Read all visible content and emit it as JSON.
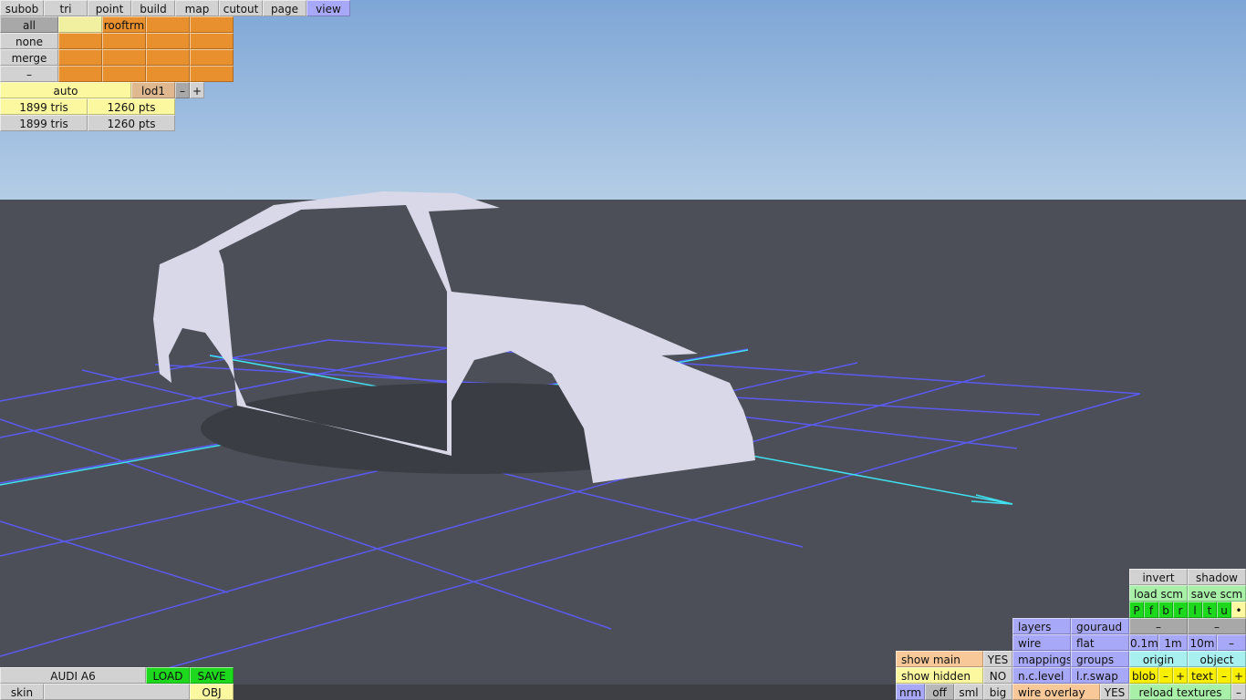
{
  "top_tabs": [
    "subob",
    "tri",
    "point",
    "build",
    "map",
    "cutout",
    "page",
    "view"
  ],
  "active_tab": "view",
  "subobject_panel": {
    "all": "all",
    "none": "none",
    "merge": "merge",
    "dash": "–",
    "selected_slot": "",
    "slot_label": "rooftrm"
  },
  "lod": {
    "mode": "auto",
    "level": "lod1",
    "minus": "–",
    "plus": "+"
  },
  "stats": {
    "tris1": "1899 tris",
    "pts1": "1260 pts",
    "tris2": "1899 tris",
    "pts2": "1260 pts"
  },
  "model": {
    "name": "AUDI A6",
    "load": "LOAD",
    "save": "SAVE",
    "skin_label": "skin",
    "skin_value": "",
    "export": "OBJ"
  },
  "right_panel": {
    "invert": "invert",
    "shadow": "shadow",
    "load_scm": "load scm",
    "save_scm": "save scm",
    "views": [
      "P",
      "f",
      "b",
      "r",
      "l",
      "t",
      "u",
      "•"
    ],
    "dash1": "–",
    "dash2": "–",
    "grid": [
      "0.1m",
      "1m",
      "10m",
      "–"
    ],
    "origin": "origin",
    "object": "object",
    "blob": "blob",
    "blob_minus": "–",
    "blob_plus": "+",
    "text": "text",
    "text_minus": "–",
    "text_plus": "+",
    "reload": "reload textures",
    "reload_minus": "–",
    "layers": "layers",
    "gouraud": "gouraud",
    "wire": "wire",
    "flat": "flat",
    "mappings": "mappings",
    "groups": "groups",
    "nclevel": "n.c.level",
    "lrswap": "l.r.swap",
    "wire_overlay": "wire overlay",
    "wire_overlay_val": "YES",
    "show_main": "show main",
    "show_main_val": "YES",
    "show_hidden": "show hidden",
    "show_hidden_val": "NO",
    "sizes": [
      "nrm",
      "off",
      "sml",
      "big"
    ]
  },
  "colors": {
    "sky": "#7ea6d6",
    "ground": "#4c4f57",
    "grid": "#5a5af0",
    "axis": "#40e0f0",
    "car": "#d8d8e8"
  }
}
